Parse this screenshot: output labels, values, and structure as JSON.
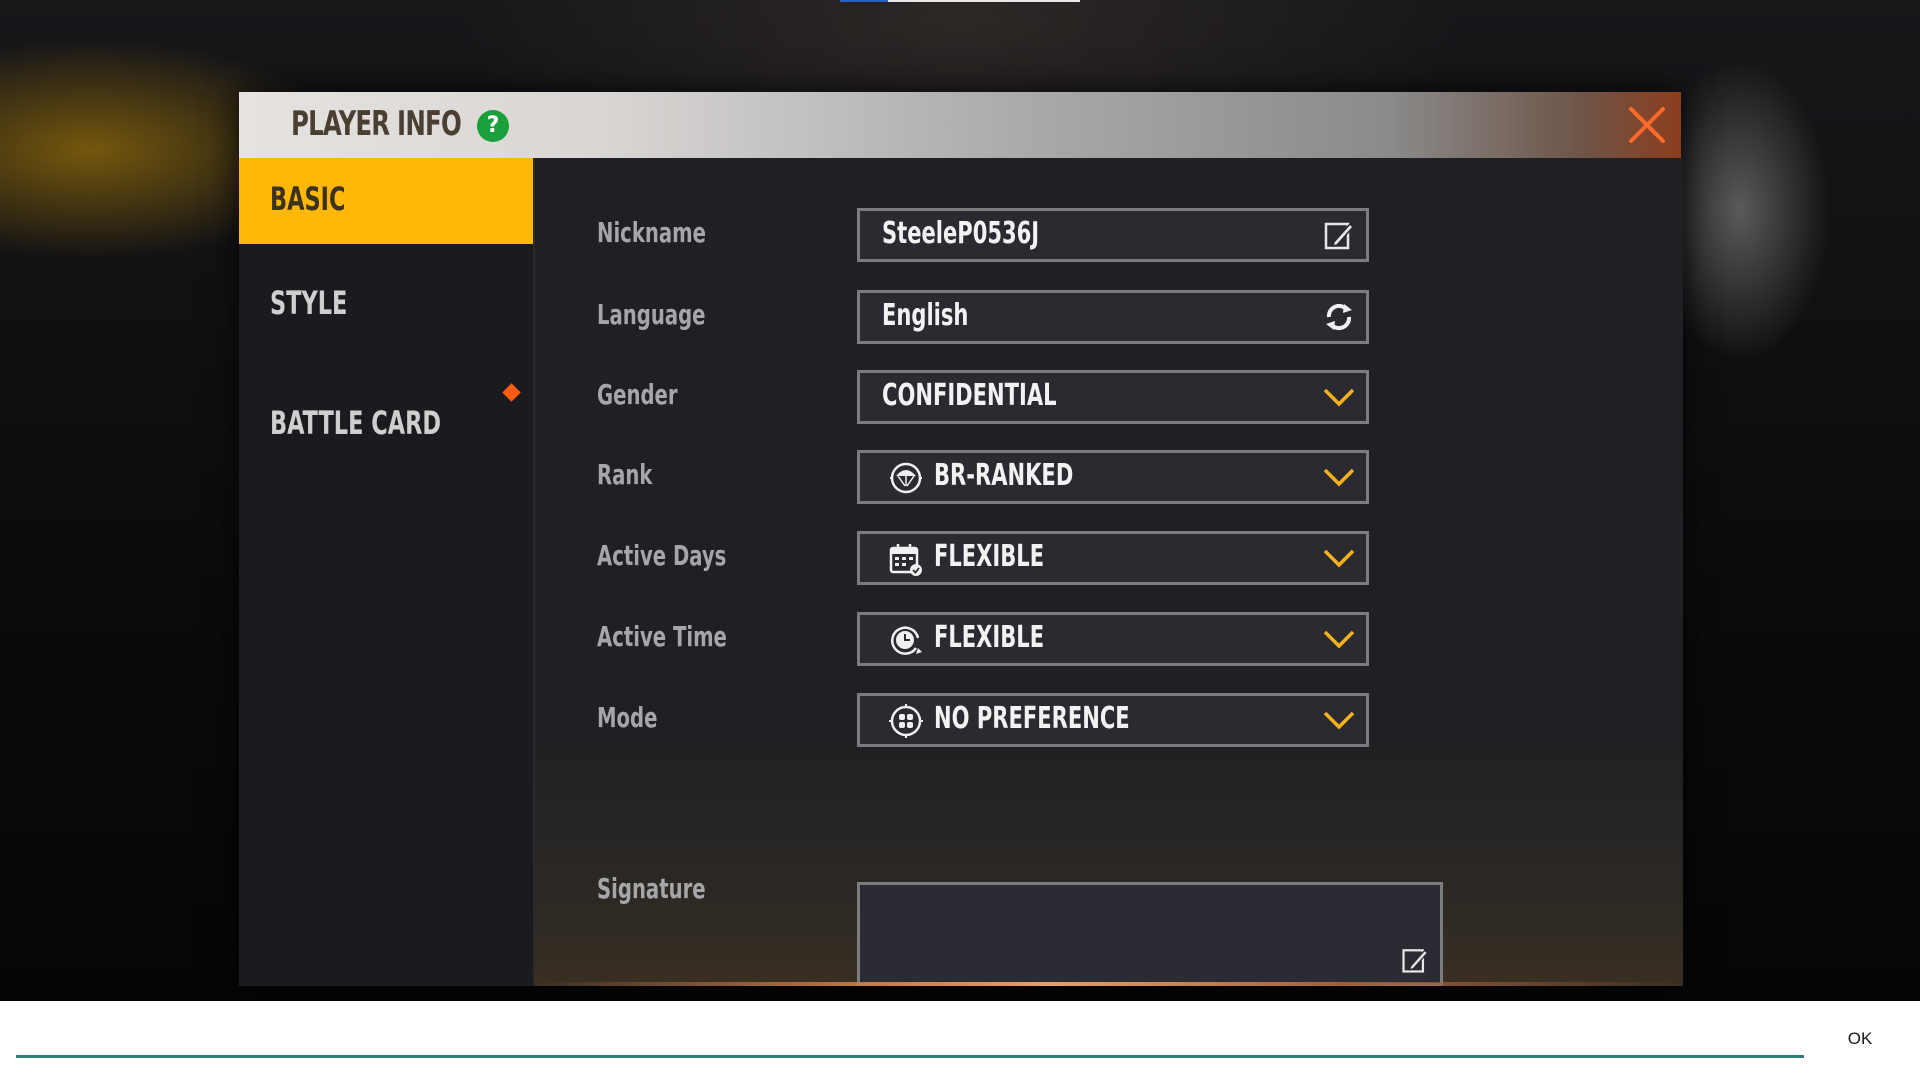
{
  "dialog": {
    "title": "PLAYER INFO",
    "help_icon": "?",
    "close_icon": "close-x-icon"
  },
  "sidebar": {
    "tabs": [
      {
        "label": "BASIC",
        "active": true
      },
      {
        "label": "STYLE",
        "active": false
      },
      {
        "label": "BATTLE CARD",
        "active": false,
        "has_notification": true
      }
    ]
  },
  "form": {
    "nickname": {
      "label": "Nickname",
      "value": "SteeleP0536J",
      "icon": "edit-icon"
    },
    "language": {
      "label": "Language",
      "value": "English",
      "icon": "refresh-icon"
    },
    "gender": {
      "label": "Gender",
      "value": "CONFIDENTIAL",
      "icon": "chevron-down-icon"
    },
    "rank": {
      "label": "Rank",
      "value": "BR-RANKED",
      "lead_icon": "parachute-icon",
      "icon": "chevron-down-icon"
    },
    "active_days": {
      "label": "Active Days",
      "value": "FLEXIBLE",
      "lead_icon": "calendar-icon",
      "icon": "chevron-down-icon"
    },
    "active_time": {
      "label": "Active Time",
      "value": "FLEXIBLE",
      "lead_icon": "clock-icon",
      "icon": "chevron-down-icon"
    },
    "mode": {
      "label": "Mode",
      "value": "NO PREFERENCE",
      "lead_icon": "mode-grid-icon",
      "icon": "chevron-down-icon"
    },
    "signature": {
      "label": "Signature",
      "value": "",
      "icon": "edit-icon"
    }
  },
  "keyboard_bar": {
    "input_value": "",
    "ok_label": "OK"
  },
  "colors": {
    "accent_yellow": "#feb908",
    "close_orange": "#ff6a2a",
    "help_green": "#1aa03a",
    "notification_orange": "#ff5a14",
    "chevron_yellow": "#f5b21b",
    "input_underline": "#2f7d76"
  }
}
